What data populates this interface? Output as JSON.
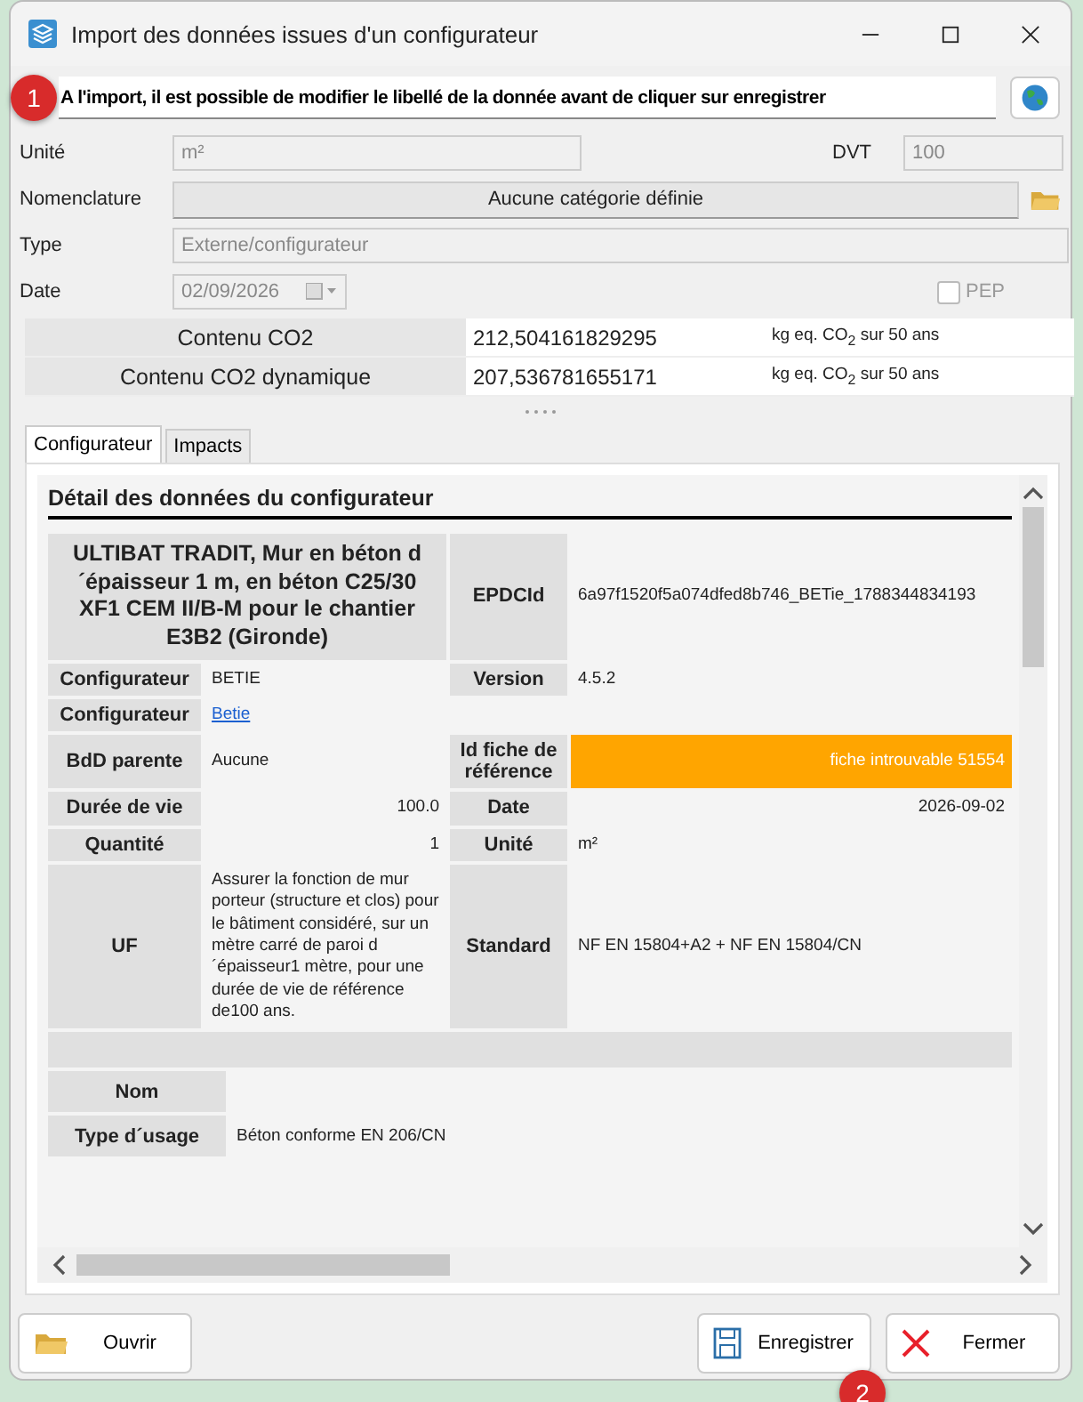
{
  "window": {
    "title": "Import des données issues d'un configurateur"
  },
  "label_field": {
    "value": "A l'import, il est possible de modifier le libellé de la donnée avant de cliquer sur enregistrer",
    "badge": "1"
  },
  "fields": {
    "unite": {
      "label": "Unité",
      "value": "m²"
    },
    "dvt": {
      "label": "DVT",
      "value": "100"
    },
    "nomenclature": {
      "label": "Nomenclature",
      "value": "Aucune catégorie définie"
    },
    "type": {
      "label": "Type",
      "value": "Externe/configurateur"
    },
    "date": {
      "label": "Date",
      "value": "02/09/2026"
    },
    "pep": {
      "label": "PEP",
      "checked": false
    }
  },
  "co2": [
    {
      "label": "Contenu CO2",
      "value": "212,504161829295",
      "unit": "kg eq. CO$_{2}$ sur 50 ans"
    },
    {
      "label": "Contenu CO2 dynamique",
      "value": "207,536781655171",
      "unit": "kg eq. CO$_{2}$ sur 50 ans"
    }
  ],
  "tabs": [
    {
      "label": "Configurateur",
      "selected": true
    },
    {
      "label": "Impacts",
      "selected": false
    }
  ],
  "detail": {
    "title": "Détail des données du configurateur",
    "rows": [
      {
        "kind": "header",
        "title": "ULTIBAT TRADIT, Mur en béton d´épaisseur 1 m, en béton C25/30 XF1 CEM II/B-M pour le chantier E3B2 (Gironde)",
        "label2": "EPDCId",
        "value2": "6a97f1520f5a074dfed8b746_BETie_1788344834193"
      },
      {
        "kind": "pair",
        "label1": "Configurateur",
        "value1": "BETIE",
        "label2": "Version",
        "value2": "4.5.2"
      },
      {
        "kind": "link",
        "label1": "Configurateur",
        "value1": "Betie"
      },
      {
        "kind": "pair",
        "label1": "BdD parente",
        "value1": "Aucune",
        "label2": "Id fiche de référence",
        "value2": "fiche introuvable 51554",
        "warning": true
      },
      {
        "kind": "pair",
        "label1": "Durée de vie",
        "value1": "100.0",
        "numeric1": true,
        "label2": "Date",
        "value2": "2026-09-02",
        "numeric2": true
      },
      {
        "kind": "pair",
        "label1": "Quantité",
        "value1": "1",
        "numeric1": true,
        "label2": "Unité",
        "value2": "m²"
      },
      {
        "kind": "pair",
        "label1": "UF",
        "value1": "Assurer la fonction de mur porteur (structure et clos) pour le bâtiment considéré, sur un mètre carré de paroi d´épaisseur1 mètre, pour une durée de vie de référence de100 ans.",
        "label2": "Standard",
        "value2": "NF EN 15804+A2 + NF EN 15804/CN"
      },
      {
        "kind": "spacer"
      },
      {
        "kind": "wide",
        "label1": "Nom"
      },
      {
        "kind": "wide",
        "label1": "Type d´usage",
        "value1": "Béton conforme EN 206/CN"
      }
    ]
  },
  "buttons": [
    {
      "kind": "open",
      "label": "Ouvrir"
    },
    {
      "kind": "save",
      "label": "Enregistrer",
      "badge": "2"
    },
    {
      "kind": "close",
      "label": "Fermer"
    }
  ]
}
